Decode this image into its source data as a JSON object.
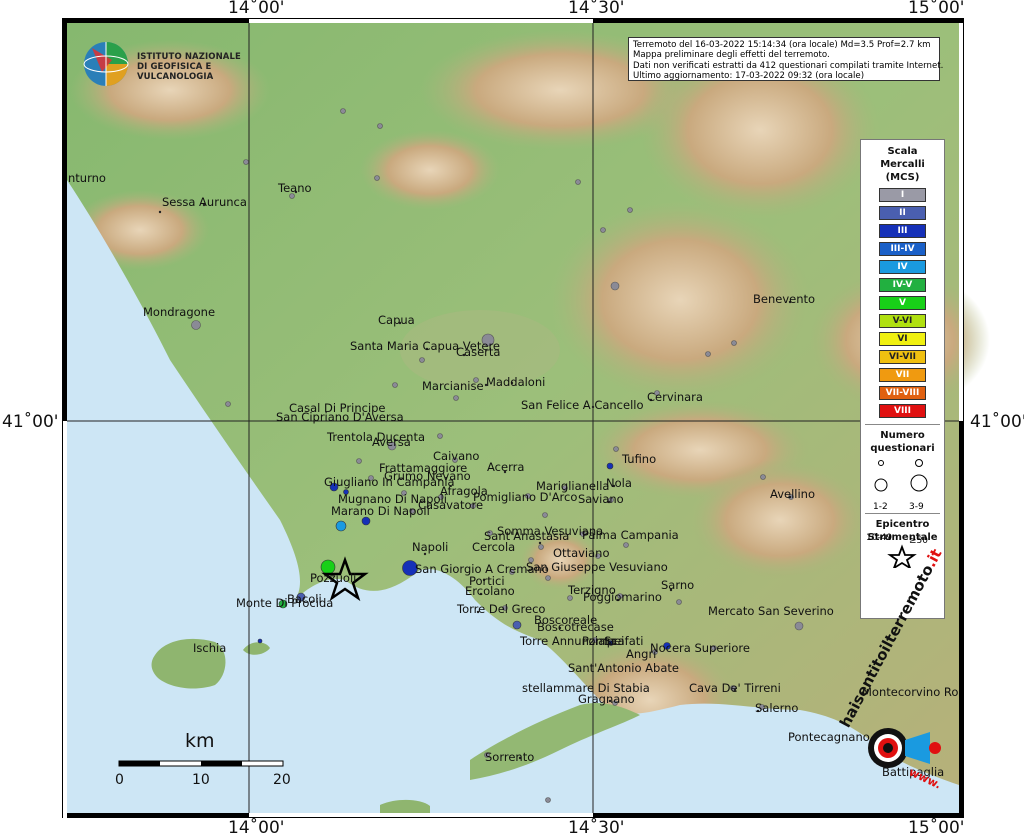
{
  "map": {
    "coord_labels": {
      "top": [
        "14˚00'",
        "14˚30'",
        "15˚00'"
      ],
      "bottom": [
        "14˚00'",
        "14˚30'",
        "15˚00'"
      ],
      "left": "41˚00'",
      "right": "41˚00'"
    },
    "places": [
      {
        "name": "nturno"
      },
      {
        "name": "Sessa Aurunca"
      },
      {
        "name": "Teano"
      },
      {
        "name": "Mondragone"
      },
      {
        "name": "Capua"
      },
      {
        "name": "Santa Maria Capua Vetere"
      },
      {
        "name": "Caserta"
      },
      {
        "name": "Marcianise"
      },
      {
        "name": "Maddaloni"
      },
      {
        "name": "Casal Di Principe"
      },
      {
        "name": "San Cipriano D'Aversa"
      },
      {
        "name": "San Felice A Cancello"
      },
      {
        "name": "Cervinara"
      },
      {
        "name": "Benevento"
      },
      {
        "name": "Trentola Ducenta"
      },
      {
        "name": "Aversa"
      },
      {
        "name": "Caivano"
      },
      {
        "name": "Acerra"
      },
      {
        "name": "Frattamaggiore"
      },
      {
        "name": "Grumo Nevano"
      },
      {
        "name": "Tufino"
      },
      {
        "name": "Giugliano In Campania"
      },
      {
        "name": "Afragola"
      },
      {
        "name": "Pomigliano D'Arco"
      },
      {
        "name": "Mariglianella"
      },
      {
        "name": "Nola"
      },
      {
        "name": "Saviano"
      },
      {
        "name": "Avellino"
      },
      {
        "name": "Mugnano Di Napoli"
      },
      {
        "name": "Casavatore"
      },
      {
        "name": "Marano Di Napoli"
      },
      {
        "name": "Somma Vesuviana"
      },
      {
        "name": "Palma Campania"
      },
      {
        "name": "Sant'Anastasia"
      },
      {
        "name": "Cercola"
      },
      {
        "name": "Napoli"
      },
      {
        "name": "Ottaviano"
      },
      {
        "name": "San Giorgio A Cremano"
      },
      {
        "name": "San Giuseppe Vesuviano"
      },
      {
        "name": "Pozzuoli"
      },
      {
        "name": "Portici"
      },
      {
        "name": "Ercolano"
      },
      {
        "name": "Terzigno"
      },
      {
        "name": "Sarno"
      },
      {
        "name": "Poggiomarino"
      },
      {
        "name": "Bacoli"
      },
      {
        "name": "Monte Di Procida"
      },
      {
        "name": "Torre Del Greco"
      },
      {
        "name": "Mercato San Severino"
      },
      {
        "name": "Boscoreale"
      },
      {
        "name": "Boscotrecase"
      },
      {
        "name": "Ischia"
      },
      {
        "name": "Torre Annunziata"
      },
      {
        "name": "Pompei"
      },
      {
        "name": "Scafati"
      },
      {
        "name": "Nocera Superiore"
      },
      {
        "name": "Angri"
      },
      {
        "name": "Sant'Antonio Abate"
      },
      {
        "name": "Montecorvino Ro"
      },
      {
        "name": "stellammare Di Stabia"
      },
      {
        "name": "Cava De' Tirreni"
      },
      {
        "name": "Gragnano"
      },
      {
        "name": "Salerno"
      },
      {
        "name": "Pontecagnano"
      },
      {
        "name": "Sorrento"
      },
      {
        "name": "Battipaglia"
      }
    ],
    "observation_points": [
      {
        "mcs": "I"
      },
      {
        "mcs": "I"
      },
      {
        "mcs": "I"
      },
      {
        "mcs": "I"
      },
      {
        "mcs": "I"
      },
      {
        "mcs": "II"
      },
      {
        "mcs": "III"
      },
      {
        "mcs": "III"
      },
      {
        "mcs": "III"
      },
      {
        "mcs": "III"
      },
      {
        "mcs": "IV"
      },
      {
        "mcs": "V"
      },
      {
        "mcs": "V"
      },
      {
        "mcs": "II"
      },
      {
        "mcs": "III"
      },
      {
        "mcs": "III"
      }
    ],
    "epicenter": {
      "label": "Epicentro Strumentale",
      "icon": "star-icon"
    },
    "colors": {
      "sea": "#cde6f5",
      "land_low": "#7fb36b",
      "land_high": "#c8a87a",
      "grid": "#222222"
    }
  },
  "logo": {
    "line1": "ISTITUTO NAZIONALE",
    "line2": "DI GEOFISICA E VULCANOLOGIA"
  },
  "info": {
    "line1": "Terremoto del 16-03-2022 15:14:34 (ora locale) Md=3.5 Prof=2.7 km",
    "line2": "Mappa preliminare degli effetti del terremoto.",
    "line3": "Dati non verificati estratti da 412 questionari compilati tramite Internet.",
    "line4": "Ultimo aggiornamento: 17-03-2022 09:32 (ora locale)"
  },
  "legend": {
    "title1": "Scala",
    "title2": "Mercalli",
    "title3": "(MCS)",
    "levels": [
      {
        "label": "I",
        "color": "#9a9aa6"
      },
      {
        "label": "II",
        "color": "#4a5fb0"
      },
      {
        "label": "III",
        "color": "#1530b8"
      },
      {
        "label": "III-IV",
        "color": "#1a60c8"
      },
      {
        "label": "IV",
        "color": "#1a9ae0"
      },
      {
        "label": "IV-V",
        "color": "#22b040"
      },
      {
        "label": "V",
        "color": "#18d018"
      },
      {
        "label": "V-VI",
        "color": "#b0e010"
      },
      {
        "label": "VI",
        "color": "#f0f010"
      },
      {
        "label": "VI-VII",
        "color": "#f0c010"
      },
      {
        "label": "VII",
        "color": "#f09a10"
      },
      {
        "label": "VII-VIII",
        "color": "#e06010"
      },
      {
        "label": "VIII",
        "color": "#e01010"
      }
    ],
    "count_title1": "Numero",
    "count_title2": "questionari",
    "counts": [
      "1-2",
      "3-9",
      "10-49",
      "≥50"
    ],
    "epi_title1": "Epicentro",
    "epi_title2": "Strumentale"
  },
  "scalebar": {
    "unit": "km",
    "ticks": [
      "0",
      "10",
      "20"
    ]
  },
  "watermark": {
    "text_main": "haisentitoilterremoto",
    "text_domain": ".it",
    "text_www": "www."
  }
}
